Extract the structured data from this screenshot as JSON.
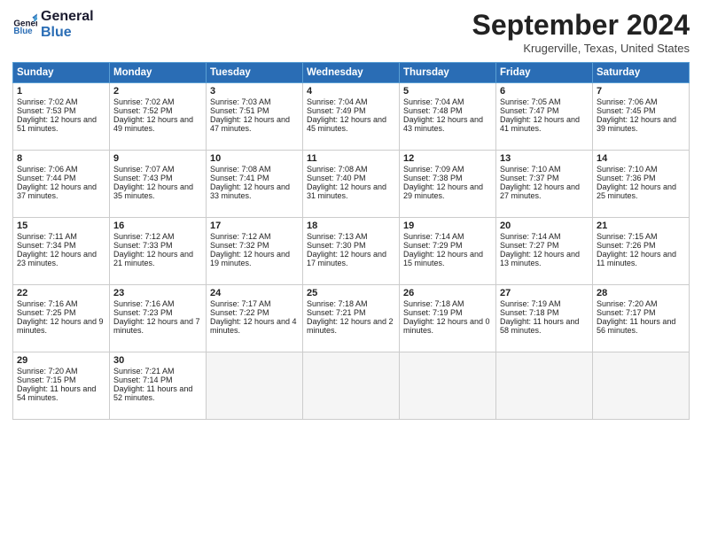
{
  "logo": {
    "line1": "General",
    "line2": "Blue"
  },
  "title": "September 2024",
  "location": "Krugerville, Texas, United States",
  "days_header": [
    "Sunday",
    "Monday",
    "Tuesday",
    "Wednesday",
    "Thursday",
    "Friday",
    "Saturday"
  ],
  "weeks": [
    [
      {
        "day": "1",
        "sunrise": "Sunrise: 7:02 AM",
        "sunset": "Sunset: 7:53 PM",
        "daylight": "Daylight: 12 hours and 51 minutes."
      },
      {
        "day": "2",
        "sunrise": "Sunrise: 7:02 AM",
        "sunset": "Sunset: 7:52 PM",
        "daylight": "Daylight: 12 hours and 49 minutes."
      },
      {
        "day": "3",
        "sunrise": "Sunrise: 7:03 AM",
        "sunset": "Sunset: 7:51 PM",
        "daylight": "Daylight: 12 hours and 47 minutes."
      },
      {
        "day": "4",
        "sunrise": "Sunrise: 7:04 AM",
        "sunset": "Sunset: 7:49 PM",
        "daylight": "Daylight: 12 hours and 45 minutes."
      },
      {
        "day": "5",
        "sunrise": "Sunrise: 7:04 AM",
        "sunset": "Sunset: 7:48 PM",
        "daylight": "Daylight: 12 hours and 43 minutes."
      },
      {
        "day": "6",
        "sunrise": "Sunrise: 7:05 AM",
        "sunset": "Sunset: 7:47 PM",
        "daylight": "Daylight: 12 hours and 41 minutes."
      },
      {
        "day": "7",
        "sunrise": "Sunrise: 7:06 AM",
        "sunset": "Sunset: 7:45 PM",
        "daylight": "Daylight: 12 hours and 39 minutes."
      }
    ],
    [
      {
        "day": "8",
        "sunrise": "Sunrise: 7:06 AM",
        "sunset": "Sunset: 7:44 PM",
        "daylight": "Daylight: 12 hours and 37 minutes."
      },
      {
        "day": "9",
        "sunrise": "Sunrise: 7:07 AM",
        "sunset": "Sunset: 7:43 PM",
        "daylight": "Daylight: 12 hours and 35 minutes."
      },
      {
        "day": "10",
        "sunrise": "Sunrise: 7:08 AM",
        "sunset": "Sunset: 7:41 PM",
        "daylight": "Daylight: 12 hours and 33 minutes."
      },
      {
        "day": "11",
        "sunrise": "Sunrise: 7:08 AM",
        "sunset": "Sunset: 7:40 PM",
        "daylight": "Daylight: 12 hours and 31 minutes."
      },
      {
        "day": "12",
        "sunrise": "Sunrise: 7:09 AM",
        "sunset": "Sunset: 7:38 PM",
        "daylight": "Daylight: 12 hours and 29 minutes."
      },
      {
        "day": "13",
        "sunrise": "Sunrise: 7:10 AM",
        "sunset": "Sunset: 7:37 PM",
        "daylight": "Daylight: 12 hours and 27 minutes."
      },
      {
        "day": "14",
        "sunrise": "Sunrise: 7:10 AM",
        "sunset": "Sunset: 7:36 PM",
        "daylight": "Daylight: 12 hours and 25 minutes."
      }
    ],
    [
      {
        "day": "15",
        "sunrise": "Sunrise: 7:11 AM",
        "sunset": "Sunset: 7:34 PM",
        "daylight": "Daylight: 12 hours and 23 minutes."
      },
      {
        "day": "16",
        "sunrise": "Sunrise: 7:12 AM",
        "sunset": "Sunset: 7:33 PM",
        "daylight": "Daylight: 12 hours and 21 minutes."
      },
      {
        "day": "17",
        "sunrise": "Sunrise: 7:12 AM",
        "sunset": "Sunset: 7:32 PM",
        "daylight": "Daylight: 12 hours and 19 minutes."
      },
      {
        "day": "18",
        "sunrise": "Sunrise: 7:13 AM",
        "sunset": "Sunset: 7:30 PM",
        "daylight": "Daylight: 12 hours and 17 minutes."
      },
      {
        "day": "19",
        "sunrise": "Sunrise: 7:14 AM",
        "sunset": "Sunset: 7:29 PM",
        "daylight": "Daylight: 12 hours and 15 minutes."
      },
      {
        "day": "20",
        "sunrise": "Sunrise: 7:14 AM",
        "sunset": "Sunset: 7:27 PM",
        "daylight": "Daylight: 12 hours and 13 minutes."
      },
      {
        "day": "21",
        "sunrise": "Sunrise: 7:15 AM",
        "sunset": "Sunset: 7:26 PM",
        "daylight": "Daylight: 12 hours and 11 minutes."
      }
    ],
    [
      {
        "day": "22",
        "sunrise": "Sunrise: 7:16 AM",
        "sunset": "Sunset: 7:25 PM",
        "daylight": "Daylight: 12 hours and 9 minutes."
      },
      {
        "day": "23",
        "sunrise": "Sunrise: 7:16 AM",
        "sunset": "Sunset: 7:23 PM",
        "daylight": "Daylight: 12 hours and 7 minutes."
      },
      {
        "day": "24",
        "sunrise": "Sunrise: 7:17 AM",
        "sunset": "Sunset: 7:22 PM",
        "daylight": "Daylight: 12 hours and 4 minutes."
      },
      {
        "day": "25",
        "sunrise": "Sunrise: 7:18 AM",
        "sunset": "Sunset: 7:21 PM",
        "daylight": "Daylight: 12 hours and 2 minutes."
      },
      {
        "day": "26",
        "sunrise": "Sunrise: 7:18 AM",
        "sunset": "Sunset: 7:19 PM",
        "daylight": "Daylight: 12 hours and 0 minutes."
      },
      {
        "day": "27",
        "sunrise": "Sunrise: 7:19 AM",
        "sunset": "Sunset: 7:18 PM",
        "daylight": "Daylight: 11 hours and 58 minutes."
      },
      {
        "day": "28",
        "sunrise": "Sunrise: 7:20 AM",
        "sunset": "Sunset: 7:17 PM",
        "daylight": "Daylight: 11 hours and 56 minutes."
      }
    ],
    [
      {
        "day": "29",
        "sunrise": "Sunrise: 7:20 AM",
        "sunset": "Sunset: 7:15 PM",
        "daylight": "Daylight: 11 hours and 54 minutes."
      },
      {
        "day": "30",
        "sunrise": "Sunrise: 7:21 AM",
        "sunset": "Sunset: 7:14 PM",
        "daylight": "Daylight: 11 hours and 52 minutes."
      },
      null,
      null,
      null,
      null,
      null
    ]
  ]
}
